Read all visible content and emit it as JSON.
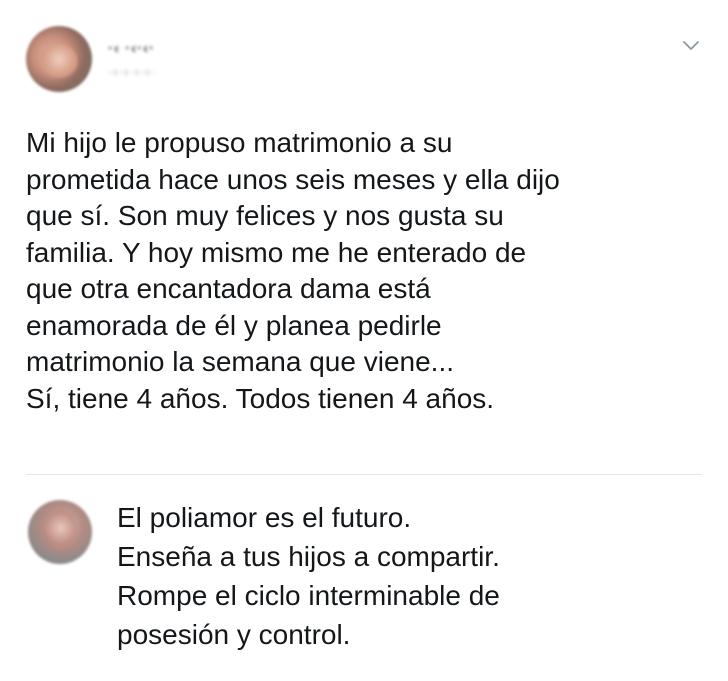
{
  "tweet": {
    "author_name": "·‹ ·‹·‹·",
    "author_handle": "·‹·‹·‹·‹·",
    "menu_icon": "chevron-down-icon",
    "avatar_icon": "avatar",
    "lines": [
      "Mi hijo le propuso matrimonio a su",
      "prometida hace unos seis meses y ella dijo",
      "que sí. Son muy felices y nos gusta su",
      "familia. Y hoy mismo me he enterado de",
      "que otra encantadora dama está",
      "enamorada de él y planea pedirle",
      "matrimonio la semana que viene...",
      "Sí, tiene 4 años. Todos tienen 4 años."
    ]
  },
  "reply": {
    "avatar_icon": "avatar",
    "lines": [
      "El poliamor es el futuro.",
      "Enseña a tus hijos a compartir.",
      "Rompe el ciclo interminable de",
      "posesión y control."
    ]
  },
  "colors": {
    "text": "#14171a",
    "divider": "#e3e6e8",
    "chevron": "#8b98a5",
    "background": "#ffffff"
  }
}
